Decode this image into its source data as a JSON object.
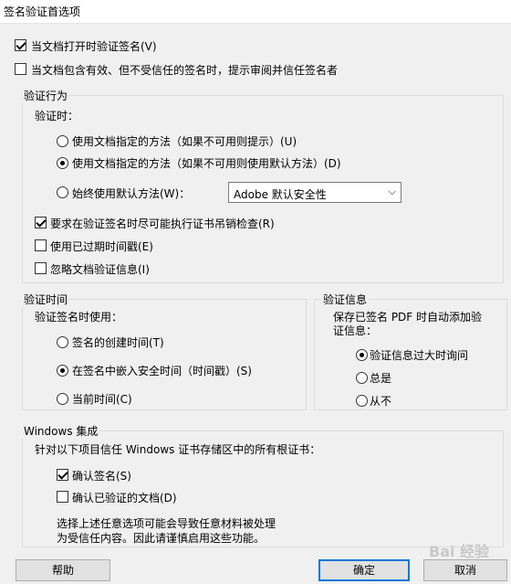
{
  "window": {
    "title": "签名验证首选项"
  },
  "top_options": {
    "verify_on_open": {
      "label": "当文档打开时验证签名(V)",
      "checked": true
    },
    "prompt_untrusted": {
      "label": "当文档包含有效、但不受信任的签名时，提示审阅并信任签名者",
      "checked": false
    }
  },
  "verify_behavior": {
    "legend": "验证行为",
    "when_label": "验证时：",
    "radios": [
      {
        "label": "使用文档指定的方法（如果不可用则提示）(U)",
        "checked": false
      },
      {
        "label": "使用文档指定的方法（如果不可用则使用默认方法）(D)",
        "checked": true
      },
      {
        "label": "始终使用默认方法(W)：",
        "checked": false
      }
    ],
    "default_method": {
      "value": "Adobe 默认安全性",
      "icon": "chevron-down-icon"
    },
    "checks": [
      {
        "label": "要求在验证签名时尽可能执行证书吊销检查(R)",
        "checked": true
      },
      {
        "label": "使用已过期时间戳(E)",
        "checked": false
      },
      {
        "label": "忽略文档验证信息(I)",
        "checked": false
      }
    ]
  },
  "verify_time": {
    "legend": "验证时间",
    "use_label": "验证签名时使用：",
    "radios": [
      {
        "label": "签名的创建时间(T)",
        "checked": false
      },
      {
        "label": "在签名中嵌入安全时间（时间戳）(S)",
        "checked": true
      },
      {
        "label": "当前时间(C)",
        "checked": false
      }
    ]
  },
  "verify_info": {
    "legend": "验证信息",
    "desc_line1": "保存已签名 PDF 时自动添加验",
    "desc_line2": "证信息：",
    "radios": [
      {
        "label": "验证信息过大时询问",
        "checked": true
      },
      {
        "label": "总是",
        "checked": false
      },
      {
        "label": "从不",
        "checked": false
      }
    ]
  },
  "windows_integration": {
    "legend": "Windows 集成",
    "trust_label": "针对以下项目信任 Windows 证书存储区中的所有根证书：",
    "checks": [
      {
        "label": "确认签名(S)",
        "checked": true
      },
      {
        "label": "确认已验证的文档(D)",
        "checked": false
      }
    ],
    "warning_line1": "选择上述任意选项可能会导致任意材料被处理",
    "warning_line2": "为受信任内容。因此请谨慎启用这些功能。"
  },
  "buttons": {
    "help": "帮助",
    "ok": "确定",
    "cancel": "取消"
  },
  "watermark": "Bai 经验"
}
